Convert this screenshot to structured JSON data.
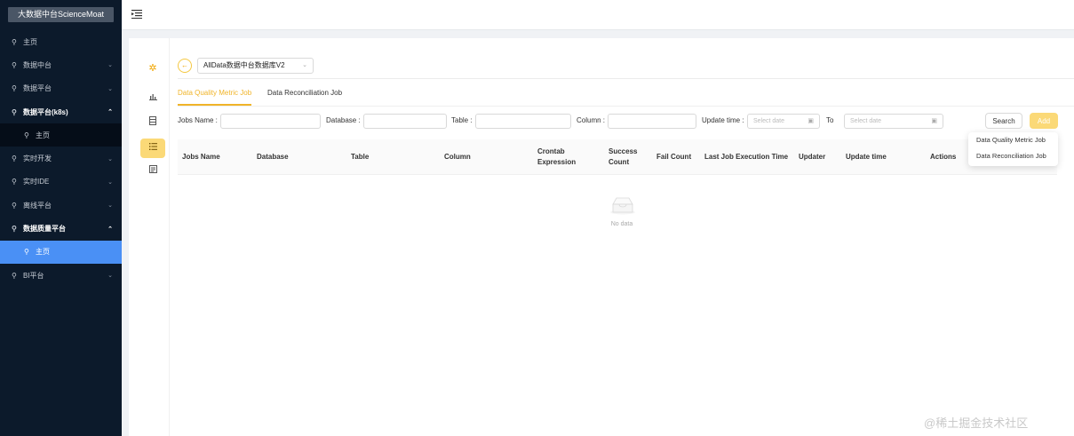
{
  "brand": {
    "title": "大数据中台ScienceMoat"
  },
  "sidebar": {
    "items": [
      {
        "label": "主页",
        "type": "plain"
      },
      {
        "label": "数据中台",
        "type": "collapsed"
      },
      {
        "label": "数据平台",
        "type": "collapsed"
      },
      {
        "label": "数据平台(k8s)",
        "type": "expanded"
      },
      {
        "label": "主页",
        "type": "sub"
      },
      {
        "label": "实时开发",
        "type": "collapsed"
      },
      {
        "label": "实时IDE",
        "type": "collapsed"
      },
      {
        "label": "离线平台",
        "type": "collapsed"
      },
      {
        "label": "数据质量平台",
        "type": "expanded"
      },
      {
        "label": "主页",
        "type": "active"
      },
      {
        "label": "BI平台",
        "type": "collapsed"
      }
    ]
  },
  "header": {
    "menu_toggle_icon": "menu-fold-icon"
  },
  "database_select": {
    "value": "AllData数据中台数据库V2"
  },
  "tabs": [
    {
      "label": "Data Quality Metric Job",
      "active": true
    },
    {
      "label": "Data Reconciliation Job",
      "active": false
    }
  ],
  "filters": {
    "jobs_name_label": "Jobs Name :",
    "database_label": "Database :",
    "table_label": "Table :",
    "column_label": "Column :",
    "update_time_label": "Update time :",
    "start_date_placeholder": "Select date",
    "to_label": "To",
    "end_date_placeholder": "Select date",
    "search_label": "Search",
    "add_label": "Add"
  },
  "add_dropdown": {
    "items": [
      "Data Quality Metric Job",
      "Data Reconciliation Job"
    ]
  },
  "table": {
    "columns": [
      "Jobs Name",
      "Database",
      "Table",
      "Column",
      "Crontab Expression",
      "Success Count",
      "Fail Count",
      "Last Job Execution Time",
      "Updater",
      "Update time",
      "Actions"
    ],
    "empty_text": "No data"
  },
  "watermark": "@稀土掘金技术社区",
  "colors": {
    "sidebar_bg": "#0c1a2b",
    "active_menu": "#4a90f5",
    "accent": "#f0b429",
    "add_button": "#fbd977"
  }
}
